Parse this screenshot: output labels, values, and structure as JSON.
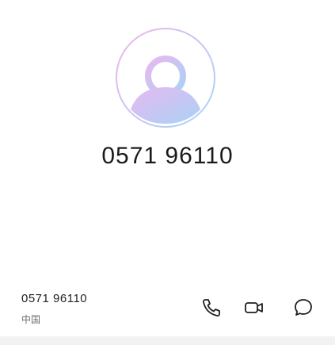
{
  "contact": {
    "display_number": "0571 96110",
    "avatar_icon": "person-avatar-icon"
  },
  "number_row": {
    "number": "0571 96110",
    "location": "中国"
  },
  "actions": [
    {
      "name": "call",
      "icon": "phone-icon"
    },
    {
      "name": "video-call",
      "icon": "video-camera-icon"
    },
    {
      "name": "message",
      "icon": "message-bubble-icon"
    }
  ],
  "colors": {
    "avatar_gradient_start": "#f0b6e8",
    "avatar_gradient_end": "#a9d4f5",
    "icon_color": "#1f1f1f"
  }
}
